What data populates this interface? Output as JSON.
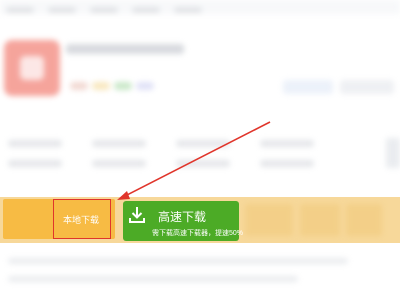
{
  "download": {
    "local_label": "本地下载",
    "fast_label": "高速下载",
    "fast_sublabel": "需下载高速下载器，提速50%"
  },
  "colors": {
    "local_button": "#f7bb44",
    "fast_button": "#4cab26",
    "highlight": "#e0352b",
    "app_icon": "#ee5a4b"
  },
  "icons": {
    "fast_download": "download-icon"
  }
}
